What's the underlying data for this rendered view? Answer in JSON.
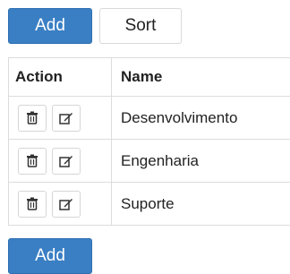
{
  "toolbar": {
    "add_label": "Add",
    "sort_label": "Sort"
  },
  "table": {
    "columns": [
      "Action",
      "Name"
    ],
    "rows": [
      {
        "name": "Desenvolvimento",
        "actions": [
          "trash-icon",
          "edit-icon"
        ]
      },
      {
        "name": "Engenharia",
        "actions": [
          "trash-icon",
          "edit-icon"
        ]
      },
      {
        "name": "Suporte",
        "actions": [
          "trash-icon",
          "edit-icon"
        ]
      }
    ]
  },
  "footer": {
    "add_label": "Add"
  },
  "colors": {
    "primary": "#3a7fc4",
    "border": "#dcdcdc"
  }
}
